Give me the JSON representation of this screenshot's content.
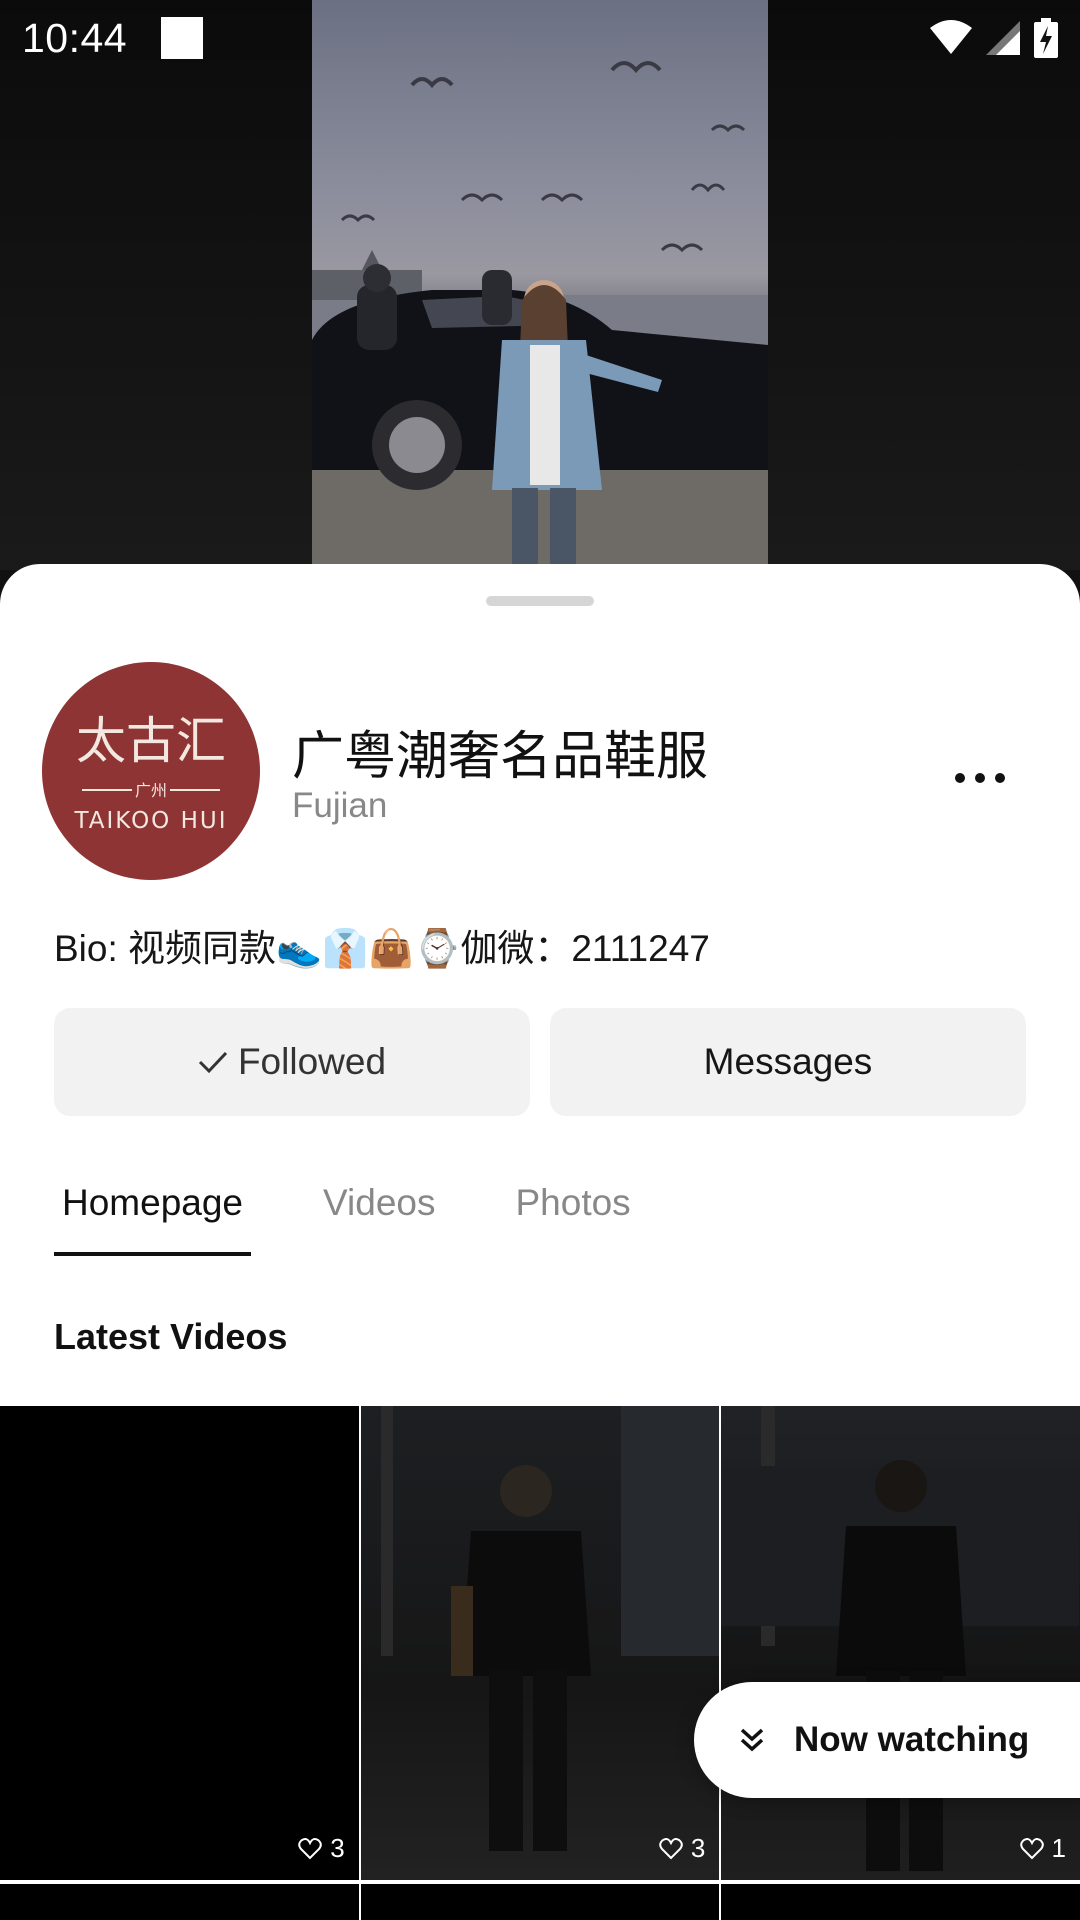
{
  "status_bar": {
    "time": "10:44",
    "icons": [
      "wifi-icon",
      "cellular-signal-icon",
      "battery-charging-icon"
    ]
  },
  "profile": {
    "name": "广粤潮奢名品鞋服",
    "location": "Fujian",
    "avatar": {
      "logo_text": "太古汇",
      "logo_subtext": "广州",
      "logo_latin": "TAIKOO HUI",
      "background": "#8e3434"
    },
    "bio": "Bio: 视频同款👟👔👜⌚伽微：2111247"
  },
  "actions": {
    "followed_label": "Followed",
    "messages_label": "Messages"
  },
  "tabs": [
    {
      "label": "Homepage",
      "active": true
    },
    {
      "label": "Videos",
      "active": false
    },
    {
      "label": "Photos",
      "active": false
    }
  ],
  "latest_videos": {
    "title": "Latest Videos",
    "items": [
      {
        "likes": "3"
      },
      {
        "likes": "3"
      },
      {
        "likes": "1"
      }
    ]
  },
  "now_watching": {
    "label": "Now watching"
  }
}
